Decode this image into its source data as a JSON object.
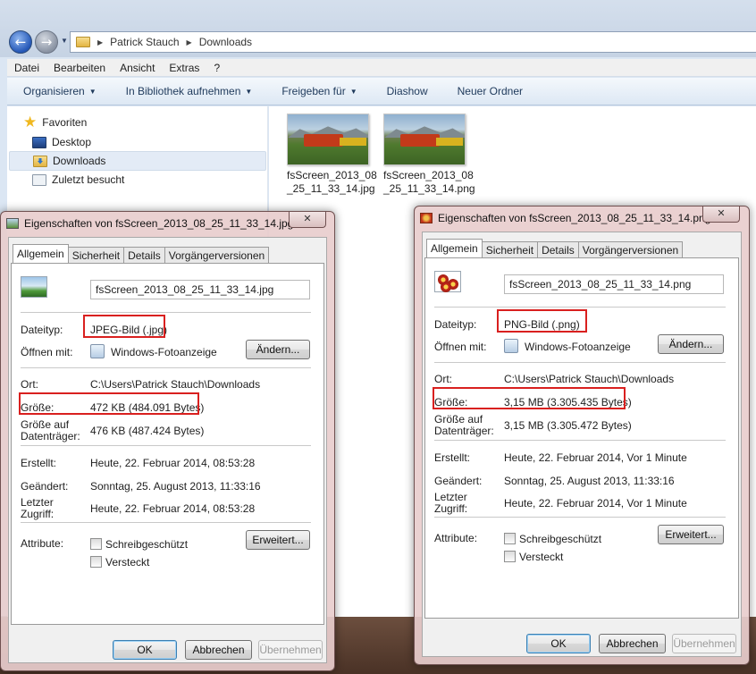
{
  "explorer": {
    "breadcrumb": [
      "Patrick Stauch",
      "Downloads"
    ],
    "menu": [
      "Datei",
      "Bearbeiten",
      "Ansicht",
      "Extras",
      "?"
    ],
    "toolbar": {
      "organize": "Organisieren",
      "library": "In Bibliothek aufnehmen",
      "share": "Freigeben für",
      "slideshow": "Diashow",
      "new_folder": "Neuer Ordner"
    },
    "nav": {
      "favorites": "Favoriten",
      "desktop": "Desktop",
      "downloads": "Downloads",
      "recent": "Zuletzt besucht"
    },
    "files": [
      {
        "line1": "fsScreen_2013_08",
        "line2": "_25_11_33_14.jpg"
      },
      {
        "line1": "fsScreen_2013_08",
        "line2": "_25_11_33_14.png"
      }
    ]
  },
  "dialog_common": {
    "tabs": [
      "Allgemein",
      "Sicherheit",
      "Details",
      "Vorgängerversionen"
    ],
    "labels": {
      "type": "Dateityp:",
      "open_with": "Öffnen mit:",
      "location": "Ort:",
      "size": "Größe:",
      "size_on_disk_1": "Größe auf",
      "size_on_disk_2": "Datenträger:",
      "created": "Erstellt:",
      "modified": "Geändert:",
      "accessed_1": "Letzter",
      "accessed_2": "Zugriff:",
      "attributes": "Attribute:"
    },
    "change_button": "Ändern...",
    "advanced_button": "Erweitert...",
    "readonly": "Schreibgeschützt",
    "hidden": "Versteckt",
    "ok": "OK",
    "cancel": "Abbrechen",
    "apply": "Übernehmen",
    "close_glyph": "✕"
  },
  "dialog_jpg": {
    "title": "Eigenschaften von fsScreen_2013_08_25_11_33_14.jpg",
    "filename": "fsScreen_2013_08_25_11_33_14.jpg",
    "type": "JPEG-Bild (.jpg)",
    "open_with": "Windows-Fotoanzeige",
    "location": "C:\\Users\\Patrick Stauch\\Downloads",
    "size": "472 KB (484.091 Bytes)",
    "size_on_disk": "476 KB (487.424 Bytes)",
    "created": "Heute, 22. Februar 2014, 08:53:28",
    "modified": "Sonntag, 25. August 2013, 11:33:16",
    "accessed": "Heute, 22. Februar 2014, 08:53:28"
  },
  "dialog_png": {
    "title": "Eigenschaften von fsScreen_2013_08_25_11_33_14.png",
    "filename": "fsScreen_2013_08_25_11_33_14.png",
    "type": "PNG-Bild (.png)",
    "open_with": "Windows-Fotoanzeige",
    "location": "C:\\Users\\Patrick Stauch\\Downloads",
    "size": "3,15 MB (3.305.435 Bytes)",
    "size_on_disk": "3,15 MB (3.305.472 Bytes)",
    "created": "Heute, 22. Februar 2014, Vor 1 Minute",
    "modified": "Sonntag, 25. August 2013, 11:33:16",
    "accessed": "Heute, 22. Februar 2014, Vor 1 Minute"
  },
  "colors": {
    "highlight_box": "#d9201f",
    "dialog_frame": "#e8cdcd",
    "explorer_toolbar_text": "#1e395b"
  }
}
